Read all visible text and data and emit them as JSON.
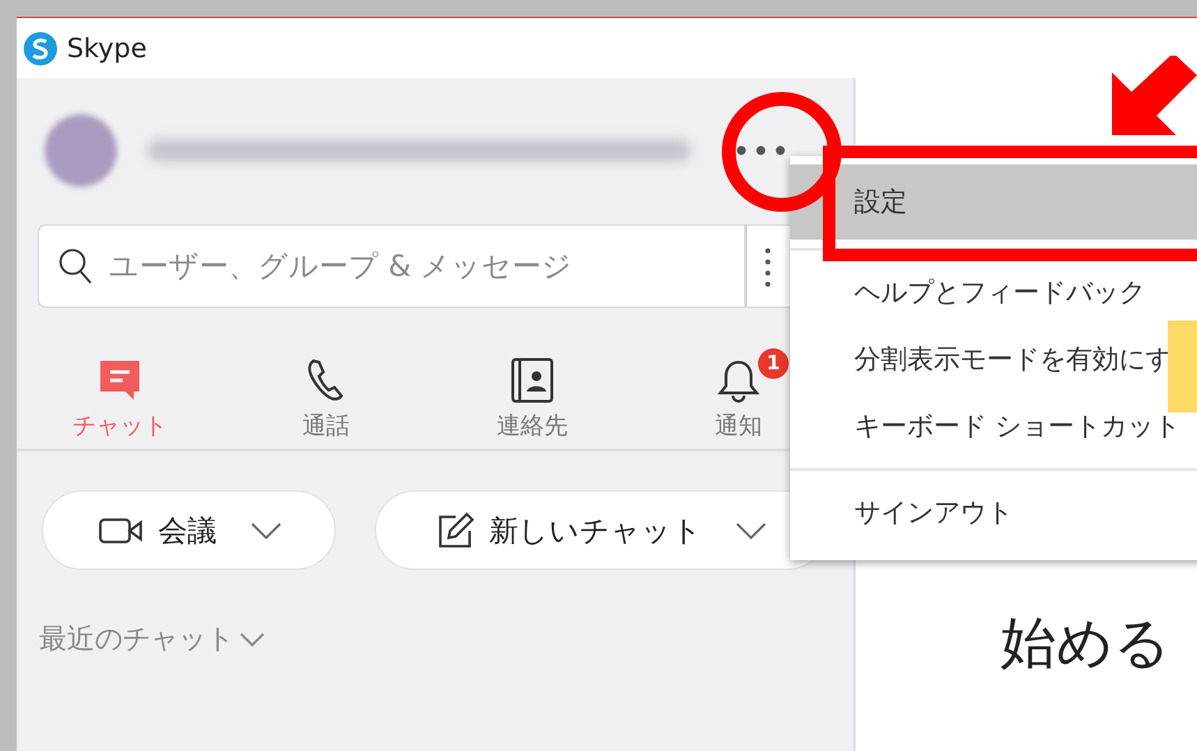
{
  "window": {
    "title": "Skype"
  },
  "search": {
    "placeholder": "ユーザー、グループ & メッセージ"
  },
  "tabs": [
    {
      "label": "チャット",
      "selected": true,
      "kind": "chat"
    },
    {
      "label": "通話",
      "selected": false,
      "kind": "call"
    },
    {
      "label": "連絡先",
      "selected": false,
      "kind": "contacts"
    },
    {
      "label": "通知",
      "selected": false,
      "kind": "notifications",
      "badge": "1"
    }
  ],
  "actions": [
    {
      "label": "会議",
      "kind": "meeting"
    },
    {
      "label": "新しいチャット",
      "kind": "new-chat"
    }
  ],
  "recent": {
    "label": "最近のチャット"
  },
  "main": {
    "heading": "始める"
  },
  "menu": {
    "sections": [
      [
        {
          "label": "設定",
          "selected": true
        }
      ],
      [
        {
          "label": "ヘルプとフィードバック",
          "selected": false
        },
        {
          "label": "分割表示モードを有効にす",
          "selected": false
        },
        {
          "label": "キーボード ショートカット",
          "selected": false
        }
      ],
      [
        {
          "label": "サインアウト",
          "selected": false
        }
      ]
    ]
  }
}
